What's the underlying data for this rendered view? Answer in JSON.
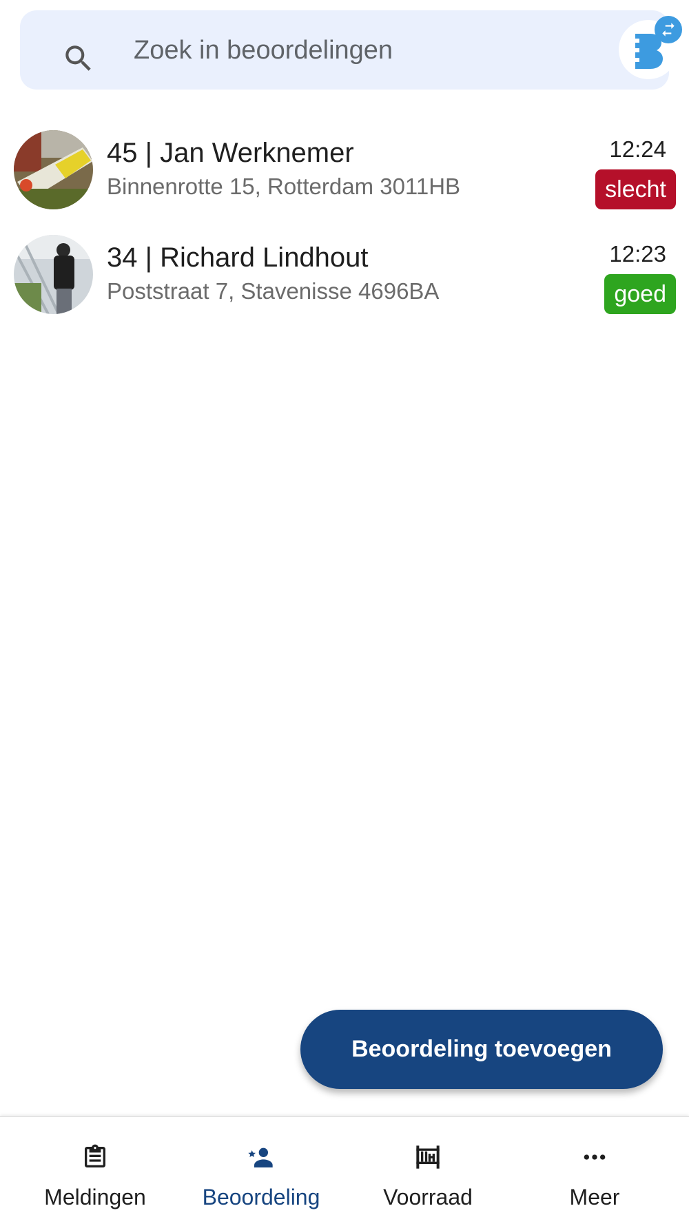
{
  "search": {
    "placeholder": "Zoek in beoordelingen",
    "icon": "search-icon",
    "profile_icon": "company-logo-icon",
    "switch_icon": "swap-icon"
  },
  "reviews": [
    {
      "title": "45 | Jan Werknemer",
      "address": "Binnenrotte 15, Rotterdam 3011HB",
      "time": "12:24",
      "rating": "slecht",
      "rating_color": "#b5102a"
    },
    {
      "title": "34 | Richard Lindhout",
      "address": "Poststraat 7, Stavenisse 4696BA",
      "time": "12:23",
      "rating": "goed",
      "rating_color": "#2ea51f"
    }
  ],
  "fab": {
    "label": "Beoordeling toevoegen"
  },
  "nav": {
    "items": [
      {
        "label": "Meldingen",
        "icon": "clipboard-icon"
      },
      {
        "label": "Beoordeling",
        "icon": "person-star-icon",
        "active": true
      },
      {
        "label": "Voorraad",
        "icon": "inventory-icon"
      },
      {
        "label": "Meer",
        "icon": "more-dots-icon"
      }
    ]
  },
  "colors": {
    "primary": "#174580",
    "search_bg": "#eaf0fd",
    "bad": "#b5102a",
    "good": "#2ea51f",
    "logo_blue": "#3d9be0"
  }
}
